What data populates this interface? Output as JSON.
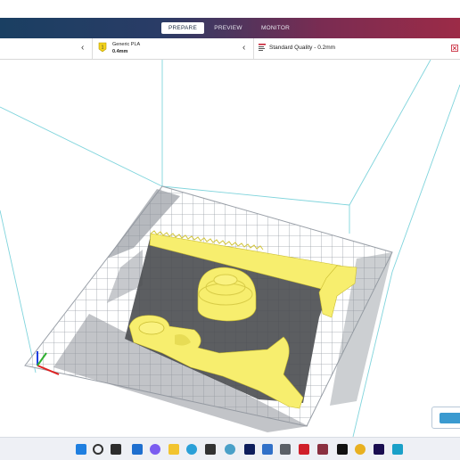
{
  "header": {
    "tabs": [
      {
        "label": "PREPARE",
        "active": true
      },
      {
        "label": "PREVIEW",
        "active": false
      },
      {
        "label": "MONITOR",
        "active": false
      }
    ]
  },
  "stage": {
    "material": {
      "name": "Generic PLA",
      "nozzle": "0.4mm",
      "icon": "extruder-icon"
    },
    "profile": {
      "name": "Standard Quality - 0.2mm",
      "icon": "profile-icon"
    }
  },
  "viewport": {
    "model_color": "#f7ee6e",
    "axes": {
      "x_color": "#e02020",
      "y_color": "#30b030",
      "z_color": "#2040e0"
    }
  },
  "taskbar": {
    "icons": [
      "windows-start-icon",
      "search-icon",
      "task-view-icon",
      "widgets-icon",
      "chat-icon",
      "file-explorer-icon",
      "edge-browser-icon",
      "store-icon",
      "app-icon",
      "photoshop-icon",
      "image-viewer-icon",
      "app-icon",
      "acrobat-icon",
      "app-icon",
      "capcut-icon",
      "chrome-icon",
      "premiere-icon",
      "cura-icon"
    ]
  }
}
